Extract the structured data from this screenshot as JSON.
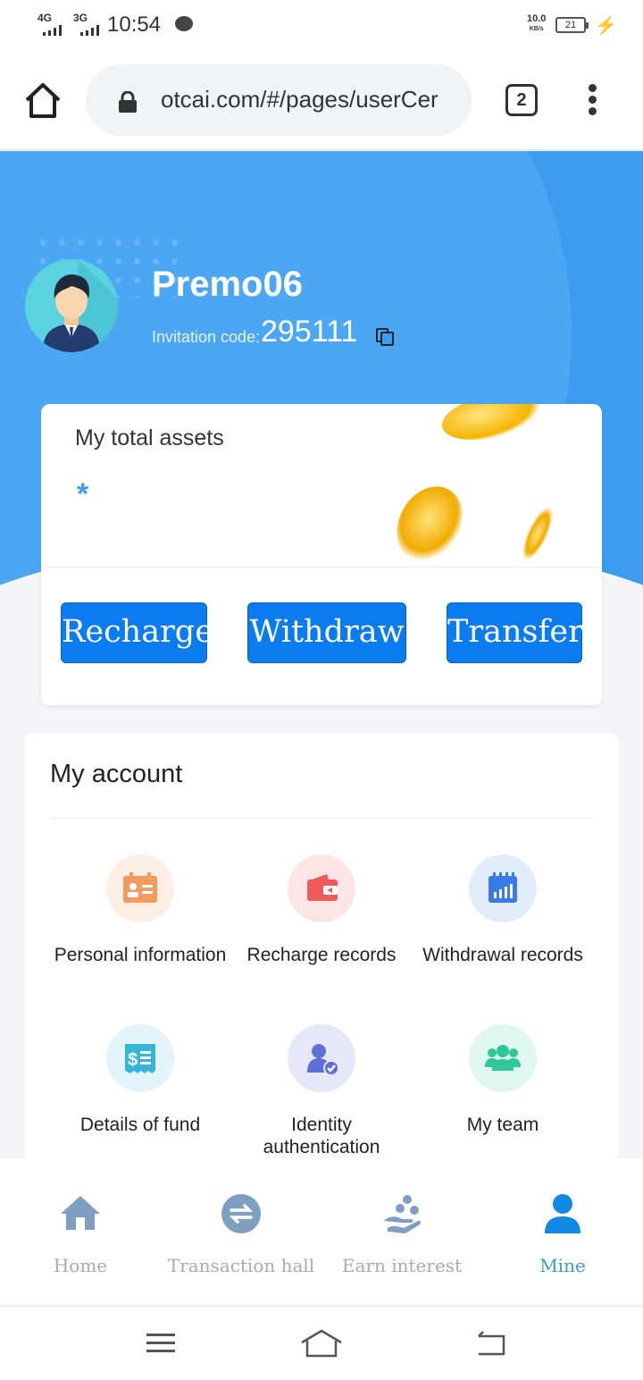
{
  "status_bar": {
    "network_1": "4G",
    "network_2": "3G",
    "time": "10:54",
    "speed_value": "10.0",
    "speed_unit": "KB/s",
    "battery": "21"
  },
  "browser": {
    "url": "otcai.com/#/pages/userCer",
    "tab_count": "2"
  },
  "profile": {
    "username": "Premo06",
    "invitation_label": "Invitation code:",
    "invitation_code": "295111"
  },
  "assets": {
    "title": "My total assets",
    "value": "*",
    "buttons": {
      "recharge": "Recharge",
      "withdraw": "Withdraw",
      "transfer": "Transfer"
    }
  },
  "account": {
    "title": "My account",
    "items": [
      {
        "label": "Personal information",
        "icon": "id-card-icon",
        "color": "#f39a5f",
        "bg": "#fdeee4"
      },
      {
        "label": "Recharge records",
        "icon": "wallet-icon",
        "color": "#ef5b5b",
        "bg": "#fde5e5"
      },
      {
        "label": "Withdrawal records",
        "icon": "bar-chart-icon",
        "color": "#3a7ce6",
        "bg": "#e2edfc"
      },
      {
        "label": "Details of fund",
        "icon": "dollar-receipt-icon",
        "color": "#36b5d8",
        "bg": "#e3f5fb"
      },
      {
        "label": "Identity authentication",
        "icon": "user-verified-icon",
        "color": "#5f6fd6",
        "bg": "#e6e8fa"
      },
      {
        "label": "My team",
        "icon": "team-icon",
        "color": "#2fc89a",
        "bg": "#dff7ef"
      }
    ]
  },
  "nav": {
    "items": [
      {
        "label": "Home",
        "icon": "home-icon"
      },
      {
        "label": "Transaction hall",
        "icon": "exchange-icon"
      },
      {
        "label": "Earn interest",
        "icon": "hand-coins-icon"
      },
      {
        "label": "Mine",
        "icon": "user-icon"
      }
    ],
    "active_color": "#3b9bd8",
    "inactive_color": "#a7aab0"
  },
  "colors": {
    "hero_blue": "#3c9df0",
    "button_blue": "#0a7cf0"
  }
}
